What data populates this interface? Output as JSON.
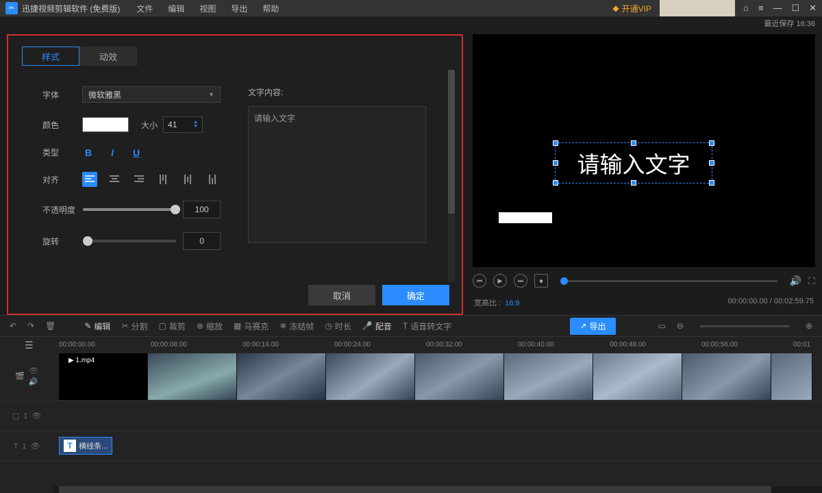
{
  "titlebar": {
    "app_name": "迅捷视频剪辑软件 (免费版)",
    "menu": [
      "文件",
      "编辑",
      "视图",
      "导出",
      "帮助"
    ],
    "vip": "开通VIP"
  },
  "save_status": "最近保存 16:36",
  "dialog": {
    "tabs": {
      "style": "样式",
      "motion": "动效"
    },
    "font_label": "字体",
    "font_value": "微软雅黑",
    "color_label": "颜色",
    "size_label": "大小",
    "size_value": "41",
    "type_label": "类型",
    "align_label": "对齐",
    "opacity_label": "不透明度",
    "opacity_value": "100",
    "rotate_label": "旋转",
    "rotate_value": "0",
    "content_label": "文字内容:",
    "content_placeholder": "请输入文字",
    "cancel": "取消",
    "ok": "确定"
  },
  "preview": {
    "text": "请输入文字",
    "aspect_label": "宽高比 :",
    "aspect_value": "16:9",
    "time_current": "00:00:00.00",
    "time_total": "00:02:59.75"
  },
  "toolbar2": {
    "edit": "编辑",
    "split": "分割",
    "crop": "裁剪",
    "zoom": "缩放",
    "mosaic": "马赛克",
    "freeze": "冻结帧",
    "duration": "时长",
    "dub": "配音",
    "stt": "语音转文字",
    "export": "导出"
  },
  "timeline": {
    "marks": [
      "00:00:00.00",
      "00:00:08.00",
      "00:00:16.00",
      "00:00:24.00",
      "00:00:32.00",
      "00:00:40.00",
      "00:00:48.00",
      "00:00:56.00",
      "00:01"
    ],
    "clip_name": "1.mp4",
    "text_clip": "横线条..."
  }
}
